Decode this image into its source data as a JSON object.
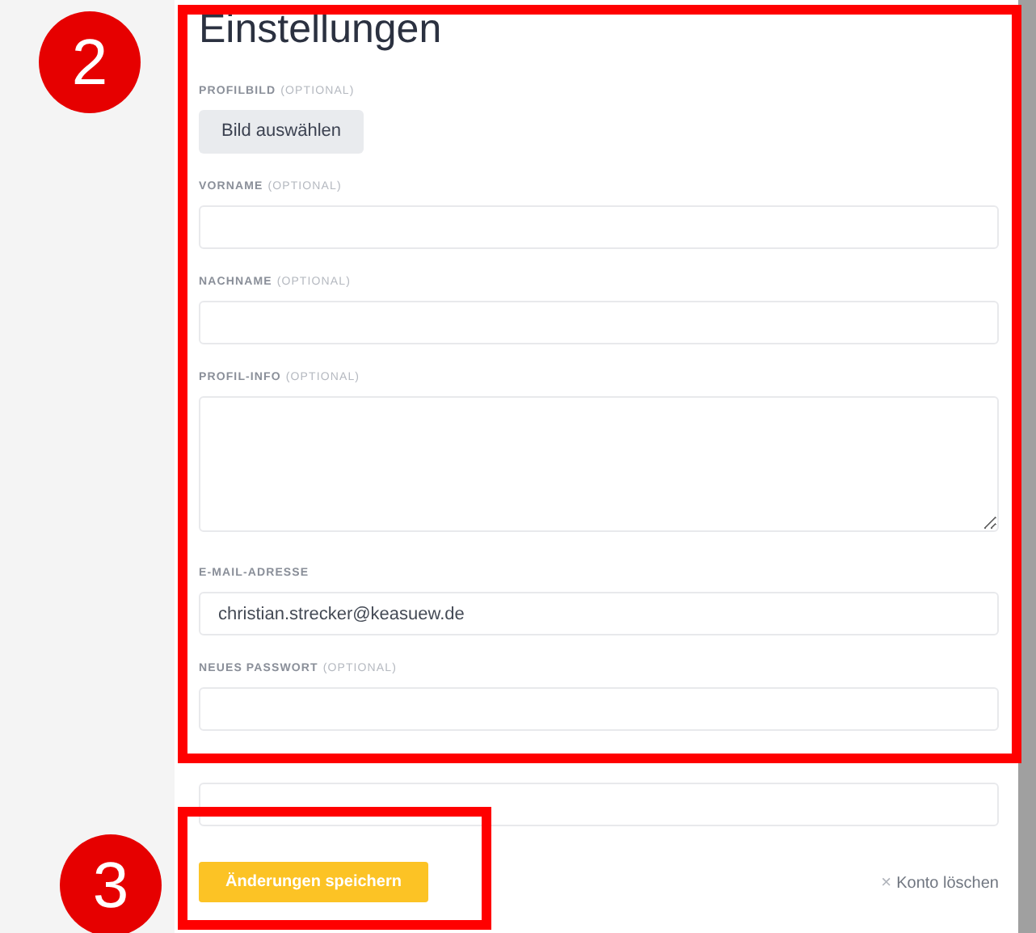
{
  "title": "Einstellungen",
  "fields": [
    {
      "kind": "button",
      "label": "PROFILBILD",
      "note": "(OPTIONAL)",
      "button": "Bild auswählen"
    },
    {
      "kind": "input",
      "label": "VORNAME",
      "note": "(OPTIONAL)"
    },
    {
      "kind": "input",
      "label": "NACHNAME",
      "note": "(OPTIONAL)"
    },
    {
      "kind": "textarea",
      "label": "PROFIL-INFO",
      "note": "(OPTIONAL)"
    },
    {
      "kind": "input",
      "label": "E-MAIL-ADRESSE",
      "value": "christian.strecker@keasuew.de"
    },
    {
      "kind": "input",
      "label": "NEUES PASSWORT",
      "note": "(OPTIONAL)"
    },
    {
      "kind": "input"
    }
  ],
  "save_button": "Änderungen speichern",
  "delete_link": {
    "icon": "×",
    "label": "Konto löschen"
  },
  "annotations": [
    {
      "number": "2"
    },
    {
      "number": "3"
    }
  ]
}
